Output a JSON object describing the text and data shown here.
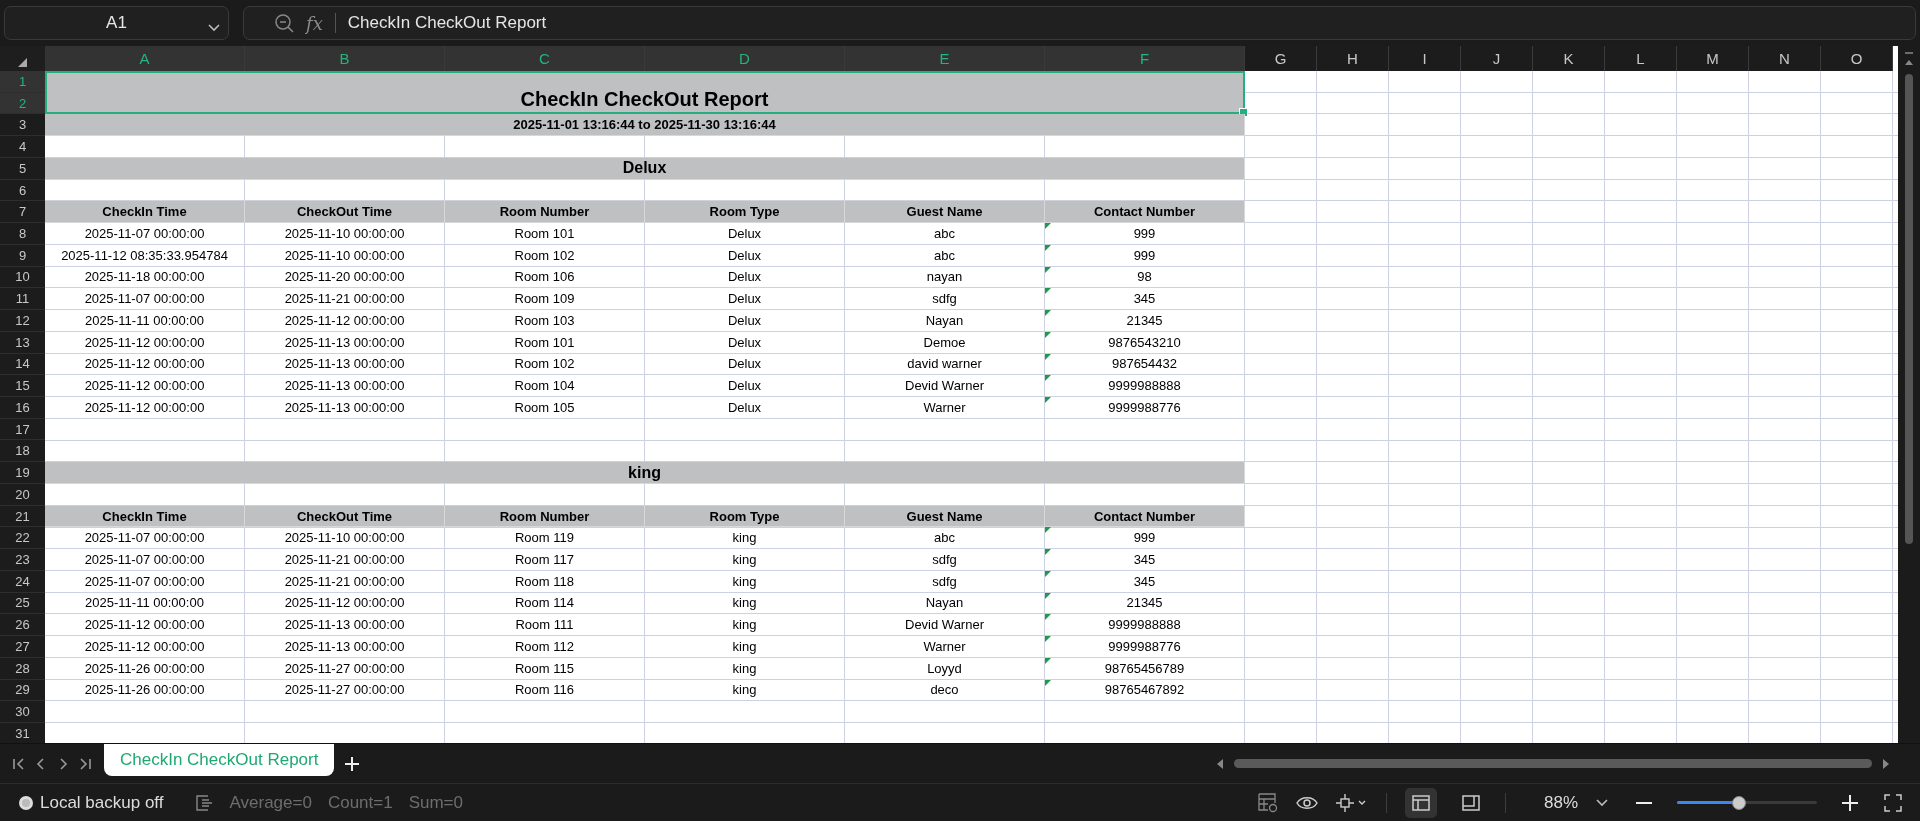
{
  "name_box": {
    "value": "A1"
  },
  "formula_bar": {
    "function_label": "fx",
    "value": "CheckIn CheckOut Report"
  },
  "column_headers": [
    {
      "label": "A",
      "selected": true
    },
    {
      "label": "B",
      "selected": true
    },
    {
      "label": "C",
      "selected": true
    },
    {
      "label": "D",
      "selected": true
    },
    {
      "label": "E",
      "selected": true
    },
    {
      "label": "F",
      "selected": true
    },
    {
      "label": "G",
      "selected": false
    },
    {
      "label": "H",
      "selected": false
    },
    {
      "label": "I",
      "selected": false
    },
    {
      "label": "J",
      "selected": false
    },
    {
      "label": "K",
      "selected": false
    },
    {
      "label": "L",
      "selected": false
    },
    {
      "label": "M",
      "selected": false
    },
    {
      "label": "N",
      "selected": false
    },
    {
      "label": "O",
      "selected": false
    }
  ],
  "row_numbers": [
    {
      "label": "1",
      "selected": true
    },
    {
      "label": "2",
      "selected": true
    },
    {
      "label": "3",
      "selected": false
    },
    {
      "label": "4",
      "selected": false
    },
    {
      "label": "5",
      "selected": false
    },
    {
      "label": "6",
      "selected": false
    },
    {
      "label": "7",
      "selected": false
    },
    {
      "label": "8",
      "selected": false
    },
    {
      "label": "9",
      "selected": false
    },
    {
      "label": "10",
      "selected": false
    },
    {
      "label": "11",
      "selected": false
    },
    {
      "label": "12",
      "selected": false
    },
    {
      "label": "13",
      "selected": false
    },
    {
      "label": "14",
      "selected": false
    },
    {
      "label": "15",
      "selected": false
    },
    {
      "label": "16",
      "selected": false
    },
    {
      "label": "17",
      "selected": false
    },
    {
      "label": "18",
      "selected": false
    },
    {
      "label": "19",
      "selected": false
    },
    {
      "label": "20",
      "selected": false
    },
    {
      "label": "21",
      "selected": false
    },
    {
      "label": "22",
      "selected": false
    },
    {
      "label": "23",
      "selected": false
    },
    {
      "label": "24",
      "selected": false
    },
    {
      "label": "25",
      "selected": false
    },
    {
      "label": "26",
      "selected": false
    },
    {
      "label": "27",
      "selected": false
    },
    {
      "label": "28",
      "selected": false
    },
    {
      "label": "29",
      "selected": false
    },
    {
      "label": "30",
      "selected": false
    },
    {
      "label": "31",
      "selected": false
    }
  ],
  "report": {
    "title": {
      "text": "CheckIn CheckOut Report",
      "selected": true
    },
    "date_range": "2025-11-01 13:16:44 to 2025-11-30 13:16:44",
    "sections": [
      {
        "name": "Delux",
        "columns": [
          "CheckIn Time",
          "CheckOut Time",
          "Room Number",
          "Room Type",
          "Guest Name",
          "Contact Number"
        ],
        "rows": [
          [
            "2025-11-07 00:00:00",
            "2025-11-10 00:00:00",
            "Room 101",
            "Delux",
            "abc",
            "999"
          ],
          [
            "2025-11-12 08:35:33.954784",
            "2025-11-10 00:00:00",
            "Room 102",
            "Delux",
            "abc",
            "999"
          ],
          [
            "2025-11-18 00:00:00",
            "2025-11-20 00:00:00",
            "Room 106",
            "Delux",
            "nayan",
            "98"
          ],
          [
            "2025-11-07 00:00:00",
            "2025-11-21 00:00:00",
            "Room 109",
            "Delux",
            "sdfg",
            "345"
          ],
          [
            "2025-11-11 00:00:00",
            "2025-11-12 00:00:00",
            "Room 103",
            "Delux",
            "Nayan",
            "21345"
          ],
          [
            "2025-11-12 00:00:00",
            "2025-11-13 00:00:00",
            "Room 101",
            "Delux",
            "Demoe",
            "9876543210"
          ],
          [
            "2025-11-12 00:00:00",
            "2025-11-13 00:00:00",
            "Room 102",
            "Delux",
            "david warner",
            "987654432"
          ],
          [
            "2025-11-12 00:00:00",
            "2025-11-13 00:00:00",
            "Room 104",
            "Delux",
            "Devid Warner",
            "9999988888"
          ],
          [
            "2025-11-12 00:00:00",
            "2025-11-13 00:00:00",
            "Room 105",
            "Delux",
            "Warner",
            "9999988776"
          ]
        ]
      },
      {
        "name": "king",
        "columns": [
          "CheckIn Time",
          "CheckOut Time",
          "Room Number",
          "Room Type",
          "Guest Name",
          "Contact Number"
        ],
        "rows": [
          [
            "2025-11-07 00:00:00",
            "2025-11-10 00:00:00",
            "Room 119",
            "king",
            "abc",
            "999"
          ],
          [
            "2025-11-07 00:00:00",
            "2025-11-21 00:00:00",
            "Room 117",
            "king",
            "sdfg",
            "345"
          ],
          [
            "2025-11-07 00:00:00",
            "2025-11-21 00:00:00",
            "Room 118",
            "king",
            "sdfg",
            "345"
          ],
          [
            "2025-11-11 00:00:00",
            "2025-11-12 00:00:00",
            "Room 114",
            "king",
            "Nayan",
            "21345"
          ],
          [
            "2025-11-12 00:00:00",
            "2025-11-13 00:00:00",
            "Room 111",
            "king",
            "Devid Warner",
            "9999988888"
          ],
          [
            "2025-11-12 00:00:00",
            "2025-11-13 00:00:00",
            "Room 112",
            "king",
            "Warner",
            "9999988776"
          ],
          [
            "2025-11-26 00:00:00",
            "2025-11-27 00:00:00",
            "Room 115",
            "king",
            "Loyyd",
            "98765456789"
          ],
          [
            "2025-11-26 00:00:00",
            "2025-11-27 00:00:00",
            "Room 116",
            "king",
            "deco",
            "98765467892"
          ]
        ]
      }
    ]
  },
  "sheet_tabs": [
    {
      "label": "CheckIn CheckOut Report",
      "selected": true
    }
  ],
  "status_bar": {
    "backup": "Local backup off",
    "average": "Average=0",
    "count": "Count=1",
    "sum": "Sum=0",
    "view_buttons": [
      {
        "kind": "normal",
        "selected": true
      },
      {
        "kind": "page_layout",
        "selected": false
      }
    ],
    "zoom": "88%",
    "zoom_slider": {
      "level": 0.44
    }
  }
}
